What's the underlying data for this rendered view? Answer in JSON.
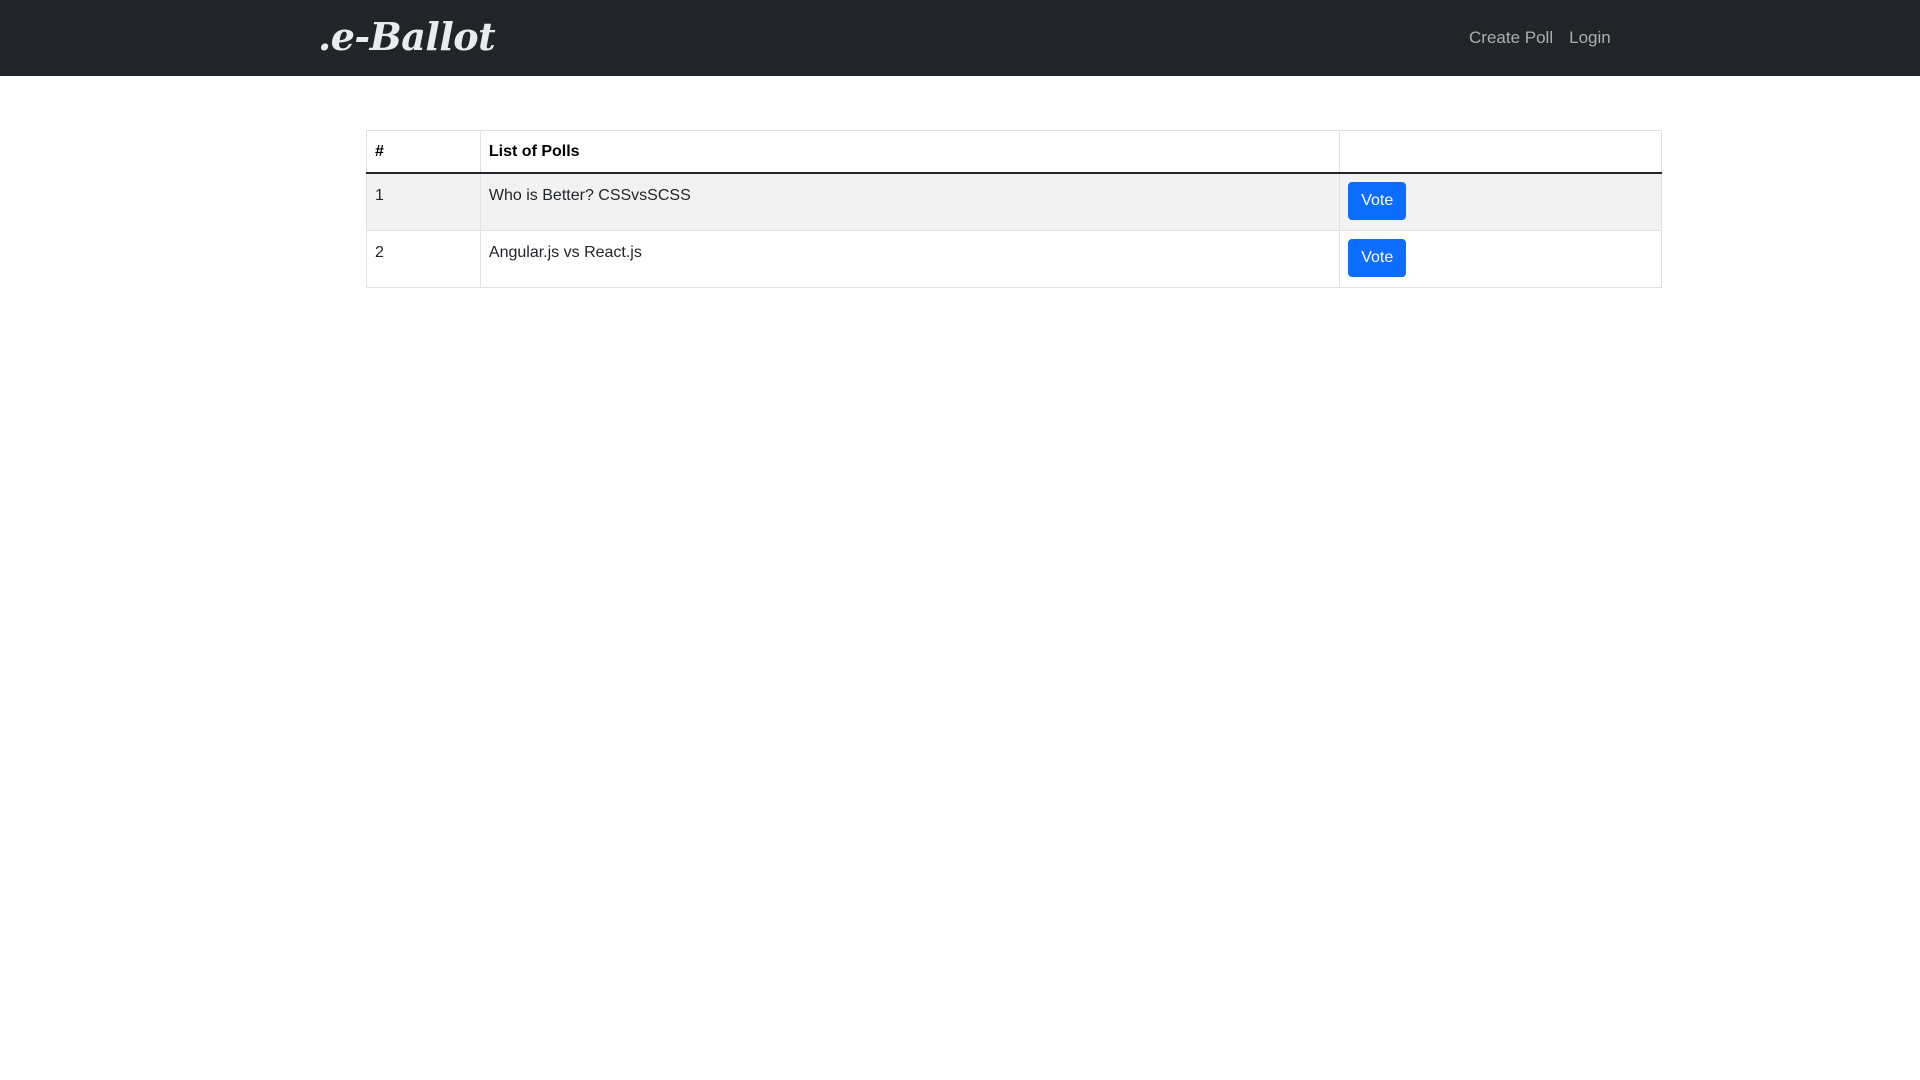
{
  "navbar": {
    "brand": ".e-Ballot",
    "links": [
      {
        "label": "Create Poll"
      },
      {
        "label": "Login"
      }
    ]
  },
  "polls_table": {
    "headers": {
      "number": "#",
      "title": "List of Polls",
      "action": ""
    },
    "rows": [
      {
        "number": "1",
        "title": "Who is Better? CSSvsSCSS",
        "action_label": "Vote"
      },
      {
        "number": "2",
        "title": "Angular.js vs React.js",
        "action_label": "Vote"
      }
    ]
  },
  "colors": {
    "navbar_bg": "#212529",
    "primary_button": "#0d6efd",
    "striped_row": "#f2f2f2"
  }
}
